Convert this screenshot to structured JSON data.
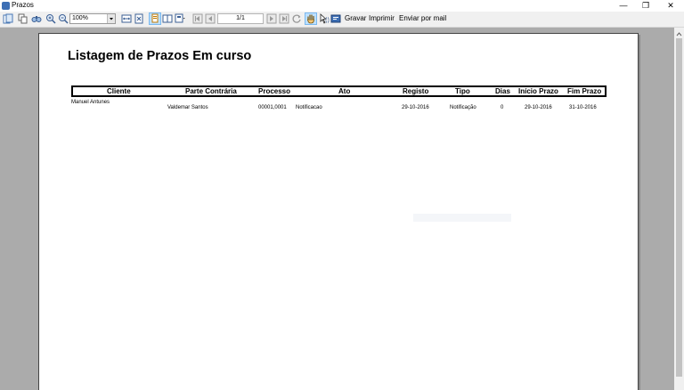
{
  "window": {
    "title": "Prazos",
    "minimize": "—",
    "maximize": "❐",
    "close": "✕"
  },
  "toolbar": {
    "zoom_value": "100%",
    "page_indicator": "1/1",
    "save_label": "Gravar",
    "print_label": "Imprimir",
    "email_label": "Enviar por mail"
  },
  "report": {
    "title": "Listagem de Prazos Em curso",
    "columns": [
      "Cliente",
      "Parte Contrária",
      "Processo",
      "Ato",
      "Registo",
      "Tipo",
      "Dias",
      "Início Prazo",
      "Fim Prazo"
    ],
    "rows": [
      {
        "cliente": "Manuel Antunes",
        "parte_contraria": "Valdemar Santos",
        "processo": "00001,0001",
        "ato": "Notificacao",
        "registo": "29-10-2016",
        "tipo": "Notificação",
        "dias": "0",
        "inicio_prazo": "29-10-2016",
        "fim_prazo": "31-10-2016"
      }
    ]
  },
  "colors": {
    "toolbar_bg": "#f0f0f0",
    "viewport_bg": "#ababab",
    "pressed_bg": "#bde0ff"
  }
}
